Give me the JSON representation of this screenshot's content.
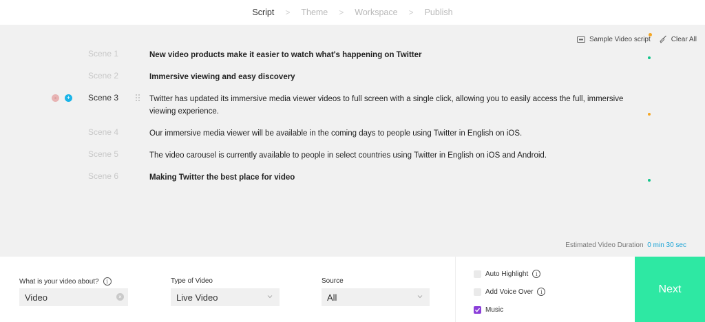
{
  "steps": [
    "Script",
    "Theme",
    "Workspace",
    "Publish"
  ],
  "step_separator": ">",
  "toolbar": {
    "sample_label": "Sample Video script",
    "clear_label": "Clear All"
  },
  "scenes": [
    {
      "label": "Scene 1",
      "text": "New video products make it easier to watch what's happening on Twitter"
    },
    {
      "label": "Scene 2",
      "text": "Immersive viewing and easy discovery"
    },
    {
      "label": "Scene 3",
      "text": "Twitter has updated its immersive media viewer videos to full screen with a single click, allowing you to easily access the full, immersive viewing experience."
    },
    {
      "label": "Scene 4",
      "text": "Our immersive media viewer will be available in the coming days to people using Twitter in English on iOS."
    },
    {
      "label": "Scene 5",
      "text": "The video carousel is currently available to people in select countries using Twitter in English on iOS and Android."
    },
    {
      "label": "Scene 6",
      "text": "Making Twitter the best place for video"
    }
  ],
  "scene_controls": {
    "minus": "-",
    "plus": "+"
  },
  "duration": {
    "label": "Estimated Video Duration",
    "value": "0 min 30 sec"
  },
  "form": {
    "about_label": "What is your video about?",
    "about_value": "Video",
    "type_label": "Type of Video",
    "type_value": "Live Video",
    "source_label": "Source",
    "source_value": "All"
  },
  "options": {
    "auto_highlight": "Auto Highlight",
    "voice_over": "Add Voice Over",
    "music": "Music",
    "music_checked": true
  },
  "next_label": "Next",
  "colors": {
    "accent_teal": "#1aa3d6",
    "next_green": "#2ee8a3",
    "dot_green": "#12c48b",
    "dot_orange": "#f5a623",
    "checkbox_purple": "#8b3fd9"
  },
  "info_icon_glyph": "i",
  "clear_glyph": "×"
}
